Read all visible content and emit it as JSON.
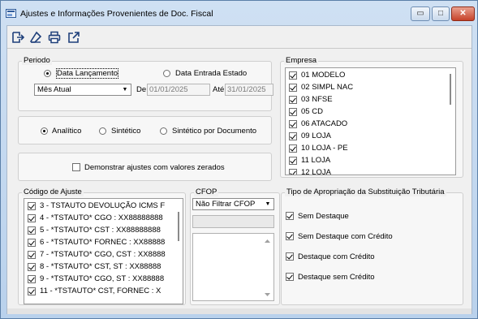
{
  "window": {
    "title": "Ajustes e Informações Provenientes de Doc. Fiscal",
    "min_glyph": "▭",
    "max_glyph": "□",
    "close_glyph": "✕"
  },
  "toolbar": {
    "icons": [
      "exit-icon",
      "eraser-icon",
      "print-icon",
      "export-icon"
    ]
  },
  "periodo": {
    "title": "Periodo",
    "radio_lancamento": "Data Lançamento",
    "radio_entrada": "Data Entrada Estado",
    "selected": "Data Lançamento",
    "period_select": "Mês Atual",
    "de_label": "De",
    "de_value": "01/01/2025",
    "ate_label": "Até",
    "ate_value": "31/01/2025"
  },
  "modo": {
    "analitico": "Analítico",
    "sintetico": "Sintético",
    "sintetico_doc": "Sintético por Documento",
    "selected": "Analítico"
  },
  "zerados": {
    "label": "Demonstrar ajustes com valores zerados",
    "checked": false
  },
  "empresa": {
    "title": "Empresa",
    "items": [
      "01 MODELO",
      "02 SIMPL NAC",
      "03 NFSE",
      "05 CD",
      "06 ATACADO",
      "09 LOJA",
      "10 LOJA - PE",
      "11 LOJA",
      "12 LOJA"
    ]
  },
  "codigo_ajuste": {
    "title": "Código de Ajuste",
    "items": [
      "3 - TSTAUTO DEVOLUÇÃO ICMS F",
      "4 - *TSTAUTO* CGO : XX88888888",
      "5 - *TSTAUTO* CST : XX88888888",
      "6 - *TSTAUTO* FORNEC : XX88888",
      "7 - *TSTAUTO* CGO, CST : XX8888",
      "8 - *TSTAUTO* CST, ST : XX88888",
      "9 - *TSTAUTO* CGO, ST : XX88888",
      "11 - *TSTAUTO* CST, FORNEC : X"
    ]
  },
  "cfop": {
    "title": "CFOP",
    "select": "Não Filtrar CFOP",
    "input_value": ""
  },
  "apropriacao": {
    "title": "Tipo de Apropriação da Substituição Tributária",
    "options": [
      "Sem Destaque",
      "Sem Destaque com Crédito",
      "Destaque com Crédito",
      "Destaque sem Crédito"
    ]
  }
}
